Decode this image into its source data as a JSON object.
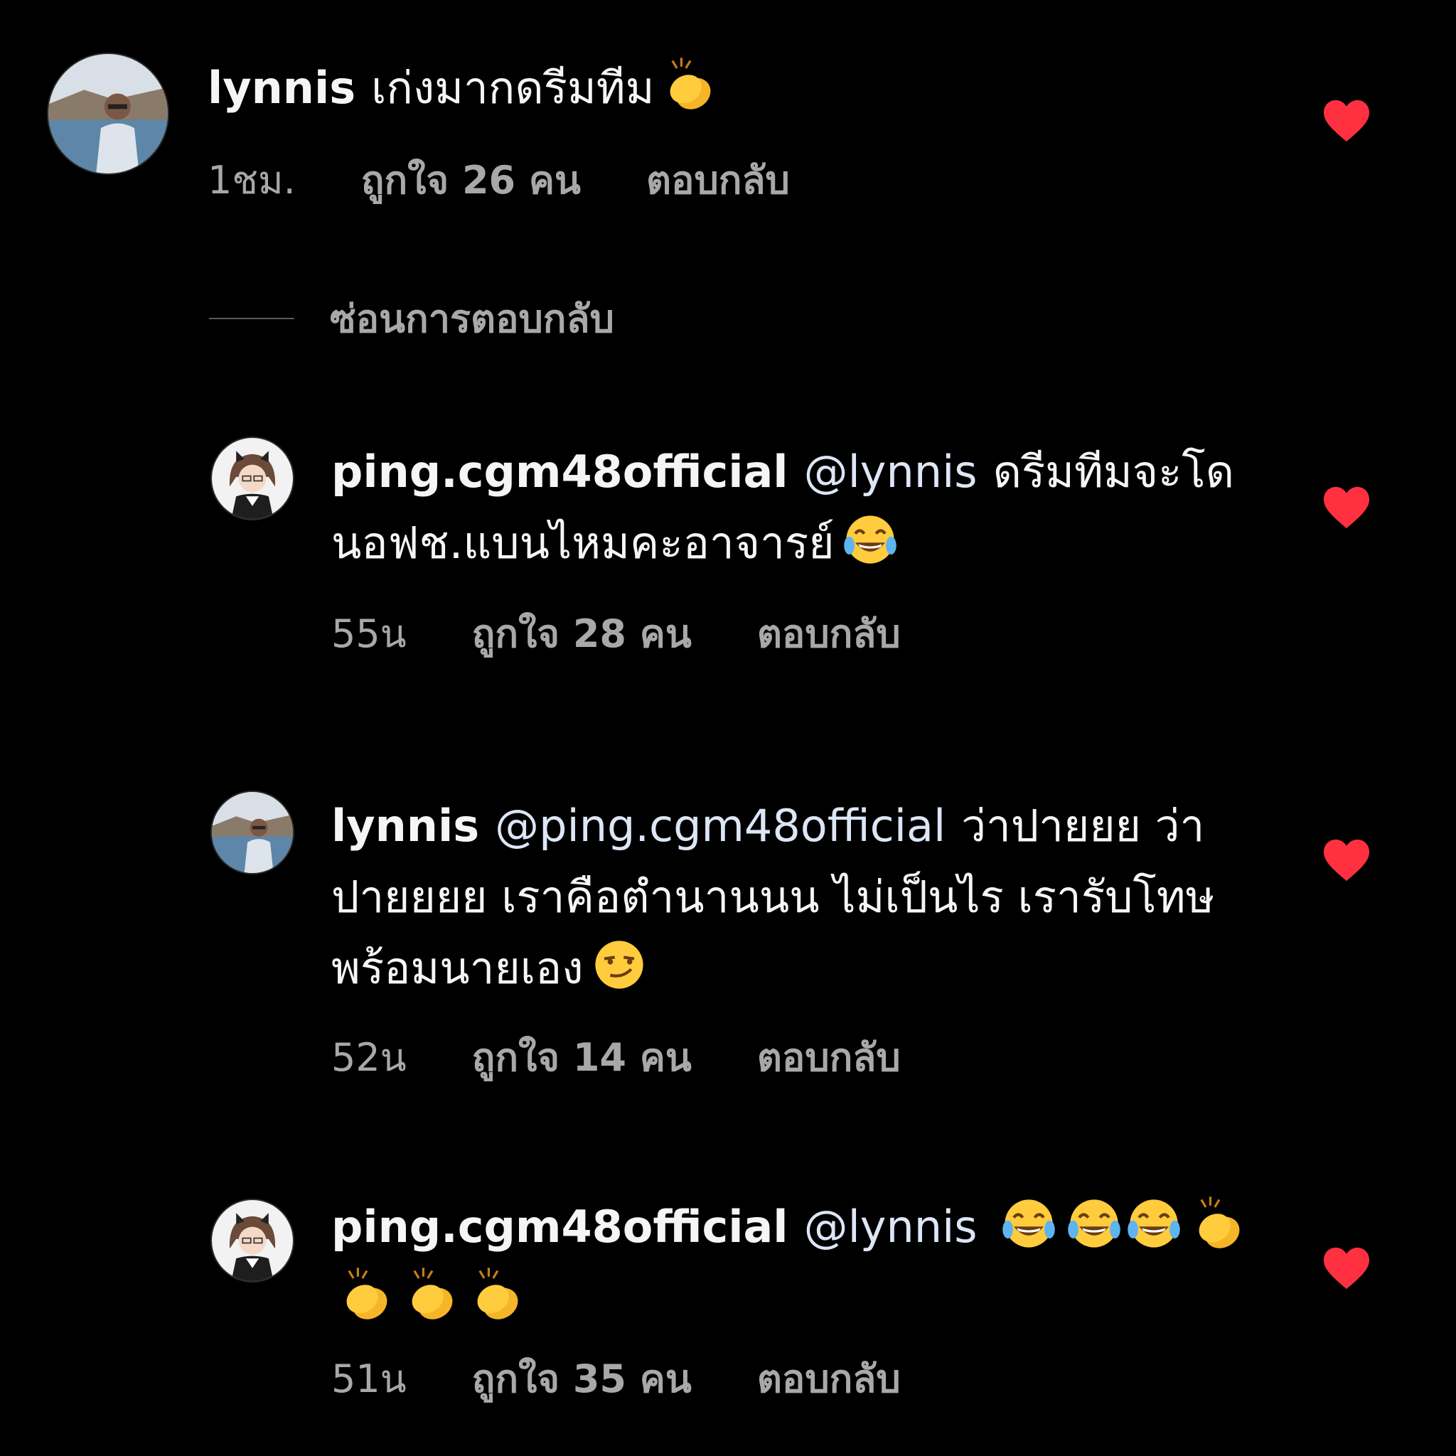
{
  "colors": {
    "background": "#000000",
    "text_primary": "#f5f5f5",
    "text_secondary": "#a8a8a8",
    "heart": "#ff3040"
  },
  "main_comment": {
    "username": "lynnis",
    "text": "เก่งมากดรีมทีม",
    "emoji": "clapping-hands",
    "time": "1ชม.",
    "likes": "ถูกใจ 26 คน",
    "reply": "ตอบกลับ"
  },
  "hide_replies_label": "ซ่อนการตอบกลับ",
  "replies": [
    {
      "username": "ping.cgm48official",
      "mention": "@lynnis",
      "text": "ดรีมทีมจะโดนอฟช.แบนไหมคะอาจารย์",
      "emoji": "face-with-tears-of-joy",
      "time": "55น",
      "likes": "ถูกใจ 28 คน",
      "reply": "ตอบกลับ"
    },
    {
      "username": "lynnis",
      "mention": "@ping.cgm48official",
      "text": "ว่าปายยย ว่าปายยยย เราคือตำนานนน ไม่เป็นไร เรารับโทษพร้อมนายเอง",
      "emoji": "smirking-face",
      "time": "52น",
      "likes": "ถูกใจ 14 คน",
      "reply": "ตอบกลับ"
    },
    {
      "username": "ping.cgm48official",
      "mention": "@lynnis",
      "text": "",
      "emoji": "face-with-tears-of-joy x3, clapping-hands x4",
      "time": "51น",
      "likes": "ถูกใจ 35 คน",
      "reply": "ตอบกลับ"
    }
  ]
}
